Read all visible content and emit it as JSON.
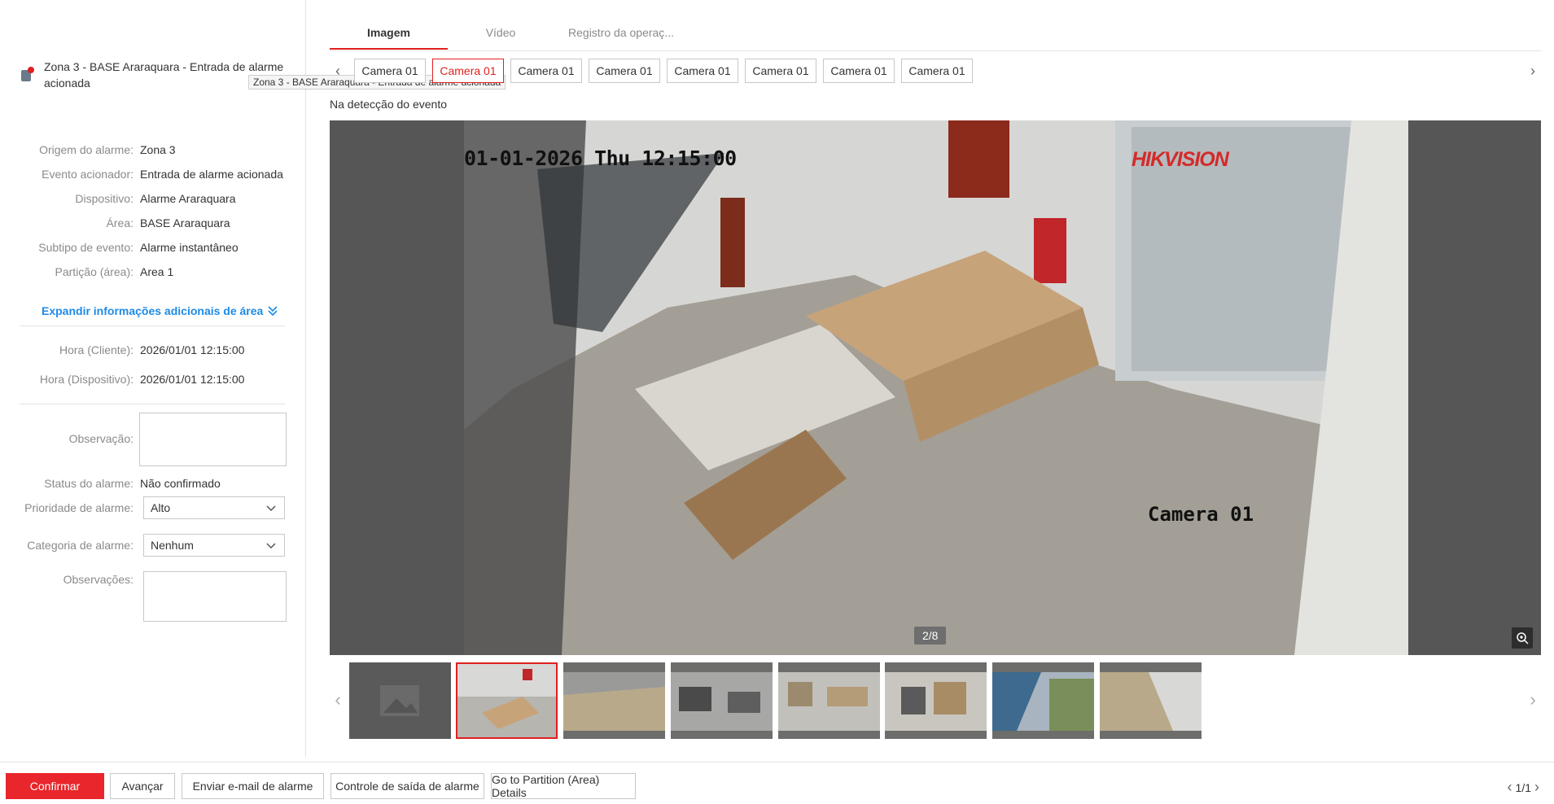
{
  "alarm": {
    "title": "Zona 3 - BASE Araraquara - Entrada de alarme acionada",
    "tooltip": "Zona 3 - BASE Araraquara - Entrada de alarme acionada"
  },
  "info": [
    {
      "label": "Origem do alarme:",
      "value": "Zona 3"
    },
    {
      "label": "Evento acionador:",
      "value": "Entrada de alarme acionada"
    },
    {
      "label": "Dispositivo:",
      "value": "Alarme Araraquara"
    },
    {
      "label": "Área:",
      "value": "BASE Araraquara"
    },
    {
      "label": "Subtipo de evento:",
      "value": "Alarme instantâneo"
    },
    {
      "label": "Partição (área):",
      "value": "Area 1"
    }
  ],
  "expand_label": "Expandir informações adicionais de área",
  "time": [
    {
      "label": "Hora (Cliente):",
      "value": "2026/01/01 12:15:00"
    },
    {
      "label": "Hora (Dispositivo):",
      "value": "2026/01/01 12:15:00"
    }
  ],
  "form": {
    "observacao_label": "Observação:",
    "status_label": "Status do alarme:",
    "status_value": "Não confirmado",
    "prioridade_label": "Prioridade de alarme:",
    "prioridade_value": "Alto",
    "categoria_label": "Categoria de alarme:",
    "categoria_value": "Nenhum",
    "observacoes_label": "Observações:"
  },
  "tabs": [
    "Imagem",
    "Vídeo",
    "Registro da operaç..."
  ],
  "cameras": [
    "Camera 01",
    "Camera 01",
    "Camera 01",
    "Camera 01",
    "Camera 01",
    "Camera 01",
    "Camera 01",
    "Camera 01"
  ],
  "event_label": "Na detecção do evento",
  "viewer": {
    "osd_time": "01-01-2026 Thu 12:15:00",
    "osd_camera": "Camera 01",
    "brand": "HIKVISION",
    "counter": "2/8"
  },
  "buttons": {
    "confirmar": "Confirmar",
    "avancar": "Avançar",
    "email": "Enviar e-mail de alarme",
    "controle": "Controle de saída de alarme",
    "partition": "Go to Partition (Area) Details"
  },
  "pager": "1/1",
  "colors": {
    "accent": "#e8262b",
    "link": "#1e8ae6"
  }
}
